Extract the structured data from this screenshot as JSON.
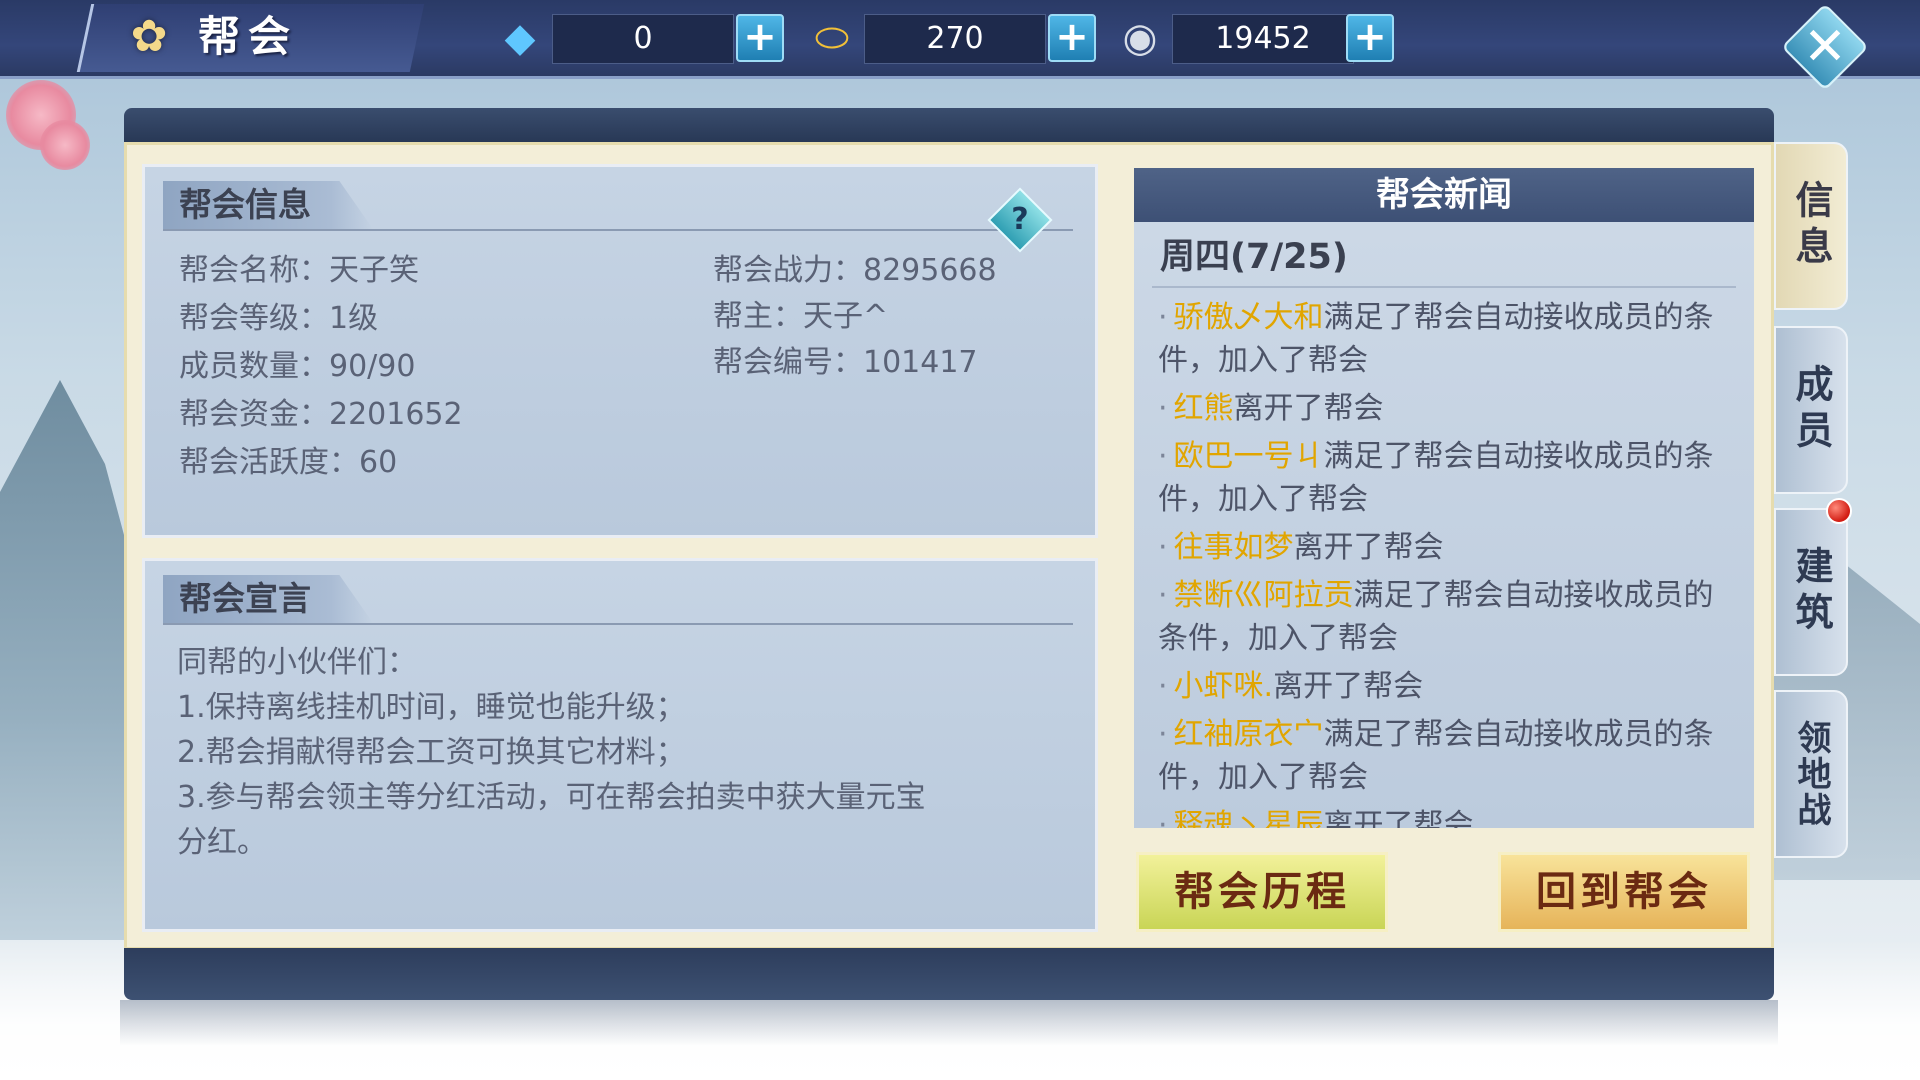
{
  "header": {
    "title": "帮会",
    "title_icon": "flower-icon",
    "currencies": [
      {
        "icon": "diamond-icon",
        "value": "0"
      },
      {
        "icon": "gold-ingot-icon",
        "value": "270"
      },
      {
        "icon": "silver-coin-icon",
        "value": "19452"
      }
    ],
    "close_icon": "close-icon"
  },
  "info_panel": {
    "title": "帮会信息",
    "help_label": "?",
    "left": [
      {
        "text": "帮会名称：天子笑"
      },
      {
        "text": "帮会等级：1级"
      },
      {
        "text": "成员数量：90/90"
      },
      {
        "text": "帮会资金：2201652"
      },
      {
        "text": "帮会活跃度：60"
      }
    ],
    "right": [
      {
        "text": "帮会战力：8295668"
      },
      {
        "text": "帮主：天子^"
      },
      {
        "text": "帮会编号：101417"
      }
    ]
  },
  "manifesto_panel": {
    "title": "帮会宣言",
    "lines": [
      {
        "text": "同帮的小伙伴们："
      },
      {
        "text": "1.保持离线挂机时间，睡觉也能升级；"
      },
      {
        "text": "2.帮会捐献得帮会工资可换其它材料；"
      },
      {
        "text": "3.参与帮会领主等分红活动，可在帮会拍卖中获大量元宝"
      },
      {
        "text": "分红。"
      }
    ]
  },
  "news_panel": {
    "title": "帮会新闻",
    "date": "周四(7/25)",
    "bullet": "·",
    "items": [
      {
        "name": "骄傲乄大和",
        "action": "满足了帮会自动接收成员的条件，加入了帮会"
      },
      {
        "name": "红熊",
        "action": "离开了帮会"
      },
      {
        "name": "欧巴一号ㄐ",
        "action": "满足了帮会自动接收成员的条件，加入了帮会"
      },
      {
        "name": "往事如梦",
        "action": "离开了帮会"
      },
      {
        "name": "禁断巛阿拉贡",
        "action": "满足了帮会自动接收成员的条件，加入了帮会"
      },
      {
        "name": "小虾咪.",
        "action": "离开了帮会"
      },
      {
        "name": "红袖原衣宀",
        "action": "满足了帮会自动接收成员的条件，加入了帮会"
      },
      {
        "name": "释魂丶星辰",
        "action": "离开了帮会"
      }
    ]
  },
  "buttons": {
    "history": "帮会历程",
    "return": "回到帮会"
  },
  "side_tabs": [
    {
      "label": "信息",
      "active": true
    },
    {
      "label": "成员",
      "active": false
    },
    {
      "label": "建筑",
      "active": false,
      "notification": true
    },
    {
      "label": "领地战",
      "active": false
    }
  ]
}
